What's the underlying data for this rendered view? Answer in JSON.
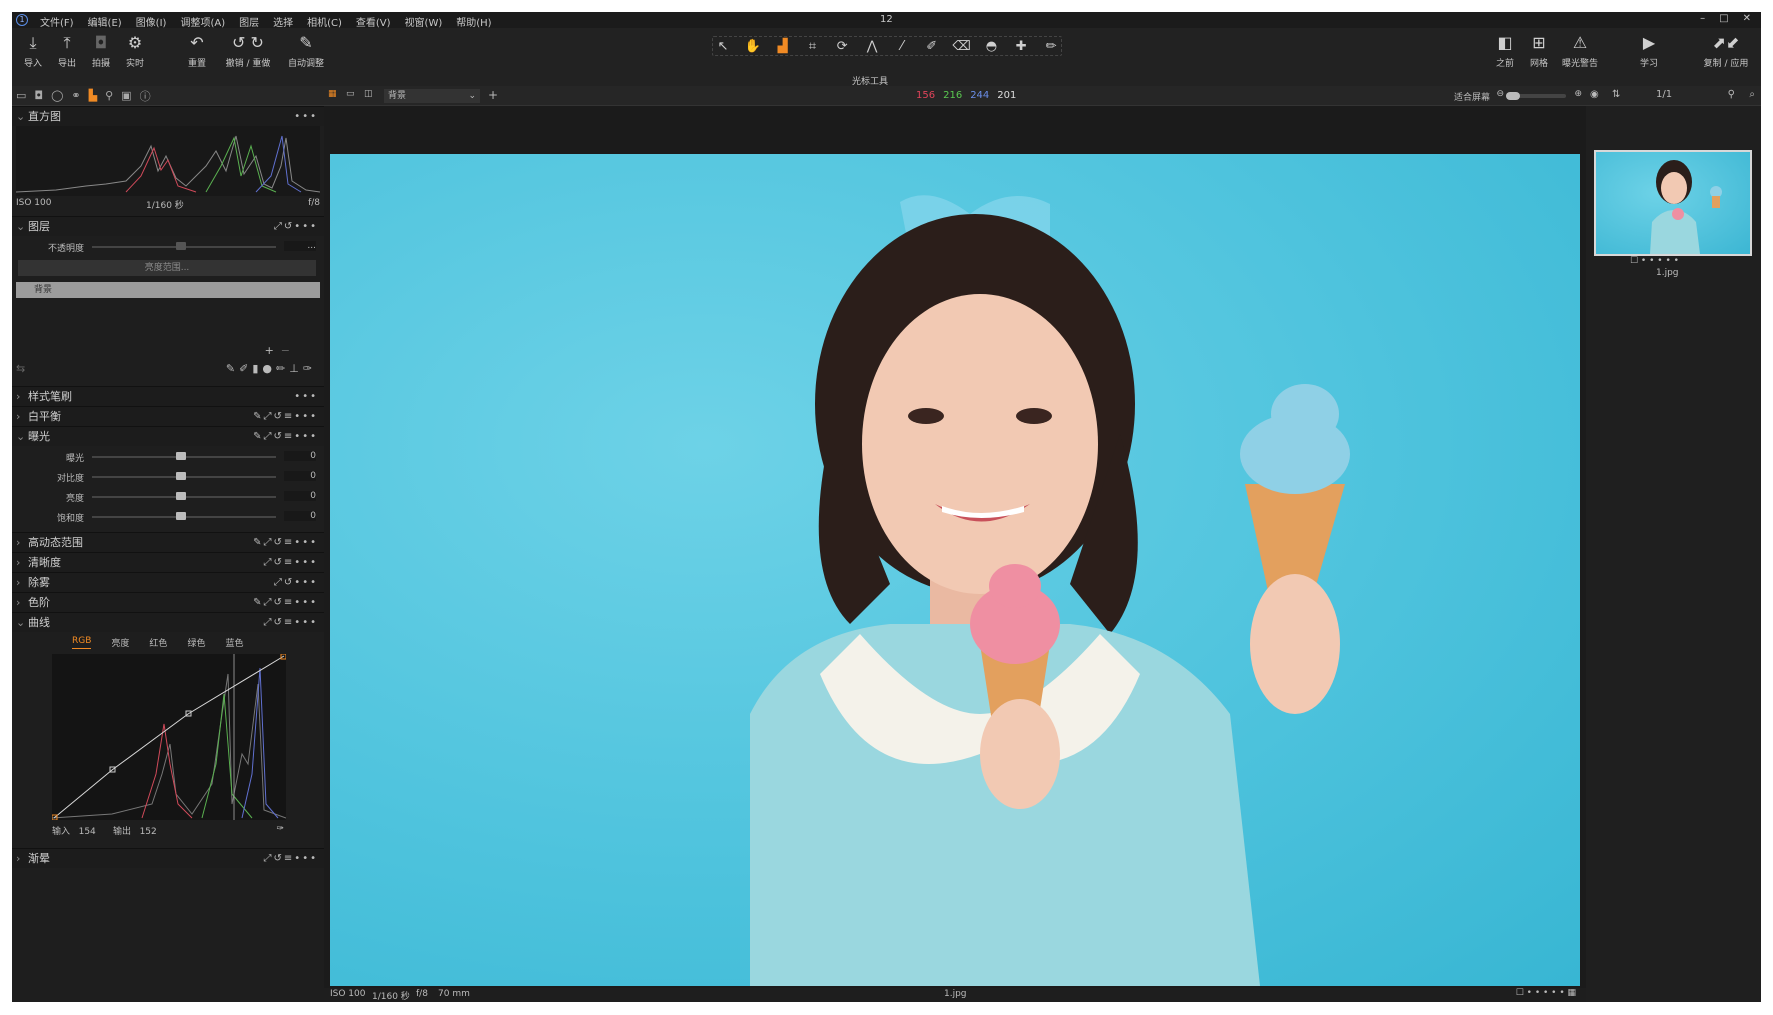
{
  "app": {
    "window_title": "12",
    "logo": "1",
    "menus": [
      "文件(F)",
      "编辑(E)",
      "图像(I)",
      "调整项(A)",
      "图层",
      "选择",
      "相机(C)",
      "查看(V)",
      "视窗(W)",
      "帮助(H)"
    ],
    "window_controls": [
      "–",
      "□",
      "✕"
    ]
  },
  "toolbar": {
    "import": "导入",
    "export": "导出",
    "capture": "拍摄",
    "live": "实时",
    "reset": "重置",
    "undo_redo": "撤销 / 重做",
    "auto_adjust": "自动调整",
    "cursor_tools_label": "光标工具",
    "before": "之前",
    "grid": "网格",
    "exposure_warning": "曝光警告",
    "learn": "学习",
    "copy_apply": "复制 / 应用"
  },
  "viewer": {
    "layer_select": "背景",
    "rgb": {
      "r": "156",
      "g": "216",
      "b": "244",
      "l": "201"
    },
    "fit_screen": "适合屏幕",
    "pager": "1/1"
  },
  "left_panel": {
    "histogram": {
      "title": "直方图",
      "iso": "ISO 100",
      "shutter": "1/160 秒",
      "aperture": "f/8"
    },
    "layers": {
      "title": "图层",
      "opacity_label": "不透明度",
      "opacity_value": "...",
      "luma_range_button": "亮度范围...",
      "background_layer": "背景"
    },
    "style_brush": {
      "title": "样式笔刷"
    },
    "white_balance": {
      "title": "白平衡"
    },
    "exposure": {
      "title": "曝光",
      "sliders": [
        {
          "label": "曝光",
          "value": "0"
        },
        {
          "label": "对比度",
          "value": "0"
        },
        {
          "label": "亮度",
          "value": "0"
        },
        {
          "label": "饱和度",
          "value": "0"
        }
      ]
    },
    "hdr": {
      "title": "高动态范围"
    },
    "clarity": {
      "title": "清晰度"
    },
    "dehaze": {
      "title": "除雾"
    },
    "levels": {
      "title": "色阶"
    },
    "curve": {
      "title": "曲线",
      "tabs": [
        "RGB",
        "亮度",
        "红色",
        "绿色",
        "蓝色"
      ],
      "input_label": "输入",
      "input_value": "154",
      "output_label": "输出",
      "output_value": "152"
    },
    "vignette": {
      "title": "渐晕"
    }
  },
  "status_bar": {
    "iso": "ISO 100",
    "shutter": "1/160 秒",
    "aperture": "f/8",
    "focal": "70 mm",
    "filename": "1.jpg"
  },
  "browser": {
    "thumb_name": "1.jpg"
  },
  "colors": {
    "accent": "#f08a24",
    "background": "#1e1e1e",
    "photo_bg": "#4ec3dd"
  }
}
